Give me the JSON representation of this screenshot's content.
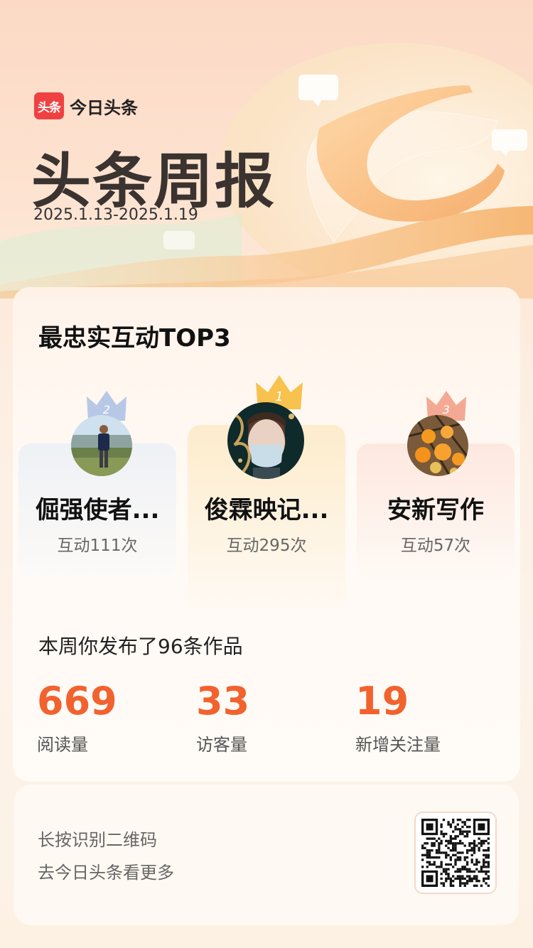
{
  "brand": {
    "logo_text": "头条",
    "app_name": "今日头条"
  },
  "report": {
    "title": "头条周报",
    "date_range": "2025.1.13-2025.1.19"
  },
  "top3": {
    "title": "最忠实互动TOP3",
    "users": [
      {
        "rank": "2",
        "name": "倔强使者...",
        "count": "互动111次"
      },
      {
        "rank": "1",
        "name": "俊霖映记...",
        "count": "互动295次"
      },
      {
        "rank": "3",
        "name": "安新写作",
        "count": "互动57次"
      }
    ]
  },
  "weekly": {
    "summary": "本周你发布了96条作品",
    "stats": [
      {
        "value": "669",
        "label": "阅读量"
      },
      {
        "value": "33",
        "label": "访客量"
      },
      {
        "value": "19",
        "label": "新增关注量"
      }
    ]
  },
  "footer": {
    "line1": "长按识别二维码",
    "line2": "去今日头条看更多"
  },
  "colors": {
    "accent": "#f2622e",
    "brand_red": "#f04142",
    "gold": "#f6c04f",
    "silver": "#9fb4d6",
    "bronze": "#f3a08a"
  }
}
